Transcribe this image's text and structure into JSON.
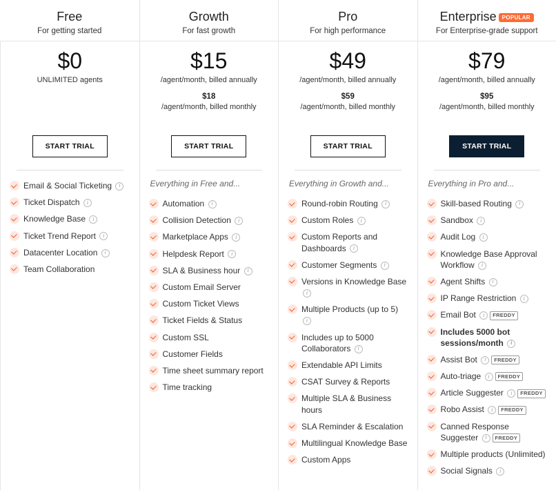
{
  "badges": {
    "popular": "POPULAR",
    "freddy": "FREDDY"
  },
  "cta": "START TRIAL",
  "plans": [
    {
      "name": "Free",
      "tagline": "For getting started",
      "price": "$0",
      "annual_note": "UNLIMITED agents",
      "monthly_price": "",
      "monthly_note": "",
      "dark_btn": false,
      "intro": "",
      "features": [
        {
          "label": "Email & Social Ticketing",
          "info": true
        },
        {
          "label": "Ticket Dispatch",
          "info": true
        },
        {
          "label": "Knowledge Base",
          "info": true
        },
        {
          "label": "Ticket Trend Report",
          "info": true
        },
        {
          "label": "Datacenter Location",
          "info": true
        },
        {
          "label": "Team Collaboration"
        }
      ]
    },
    {
      "name": "Growth",
      "tagline": "For fast growth",
      "price": "$15",
      "annual_note": "/agent/month, billed annually",
      "monthly_price": "$18",
      "monthly_note": "/agent/month, billed monthly",
      "dark_btn": false,
      "intro": "Everything in Free and...",
      "features": [
        {
          "label": "Automation",
          "info": true
        },
        {
          "label": "Collision Detection",
          "info": true
        },
        {
          "label": "Marketplace Apps",
          "info": true
        },
        {
          "label": "Helpdesk Report",
          "info": true
        },
        {
          "label": "SLA & Business hour",
          "info": true
        },
        {
          "label": "Custom Email Server"
        },
        {
          "label": "Custom Ticket Views"
        },
        {
          "label": "Ticket Fields & Status"
        },
        {
          "label": "Custom SSL"
        },
        {
          "label": "Customer Fields"
        },
        {
          "label": "Time sheet summary report"
        },
        {
          "label": "Time tracking"
        }
      ]
    },
    {
      "name": "Pro",
      "tagline": "For high performance",
      "price": "$49",
      "annual_note": "/agent/month, billed annually",
      "monthly_price": "$59",
      "monthly_note": "/agent/month, billed monthly",
      "dark_btn": false,
      "intro": "Everything in Growth and...",
      "features": [
        {
          "label": "Round-robin Routing",
          "info": true
        },
        {
          "label": "Custom Roles",
          "info": true
        },
        {
          "label": "Custom Reports and Dashboards",
          "info": true
        },
        {
          "label": "Customer Segments",
          "info": true
        },
        {
          "label": "Versions in Knowledge Base",
          "info": true
        },
        {
          "label": "Multiple Products (up to 5)",
          "info": true
        },
        {
          "label": "Includes up to 5000 Collaborators",
          "info": true
        },
        {
          "label": "Extendable API Limits"
        },
        {
          "label": "CSAT Survey & Reports"
        },
        {
          "label": "Multiple SLA & Business hours"
        },
        {
          "label": "SLA Reminder & Escalation"
        },
        {
          "label": "Multilingual Knowledge Base"
        },
        {
          "label": "Custom Apps"
        }
      ]
    },
    {
      "name": "Enterprise",
      "tagline": "For Enterprise-grade support",
      "popular": true,
      "price": "$79",
      "annual_note": "/agent/month, billed annually",
      "monthly_price": "$95",
      "monthly_note": "/agent/month, billed monthly",
      "dark_btn": true,
      "intro": "Everything in Pro and...",
      "features": [
        {
          "label": "Skill-based Routing",
          "info": true
        },
        {
          "label": "Sandbox",
          "info": true
        },
        {
          "label": "Audit Log",
          "info": true
        },
        {
          "label": "Knowledge Base Approval Workflow",
          "info": true
        },
        {
          "label": "Agent Shifts",
          "info": true
        },
        {
          "label": "IP Range Restriction",
          "info": true
        },
        {
          "label": "Email Bot",
          "info": true,
          "freddy": true
        },
        {
          "label": "Includes 5000 bot sessions/month",
          "info": true,
          "bold": true
        },
        {
          "label": "Assist Bot",
          "info": true,
          "freddy": true
        },
        {
          "label": "Auto-triage",
          "info": true,
          "freddy": true
        },
        {
          "label": "Article Suggester",
          "info": true,
          "freddy": true
        },
        {
          "label": "Robo Assist",
          "info": true,
          "freddy": true
        },
        {
          "label": "Canned Response Suggester",
          "info": true,
          "freddy": true
        },
        {
          "label": "Multiple products (Unlimited)"
        },
        {
          "label": "Social Signals",
          "info": true
        }
      ]
    }
  ]
}
